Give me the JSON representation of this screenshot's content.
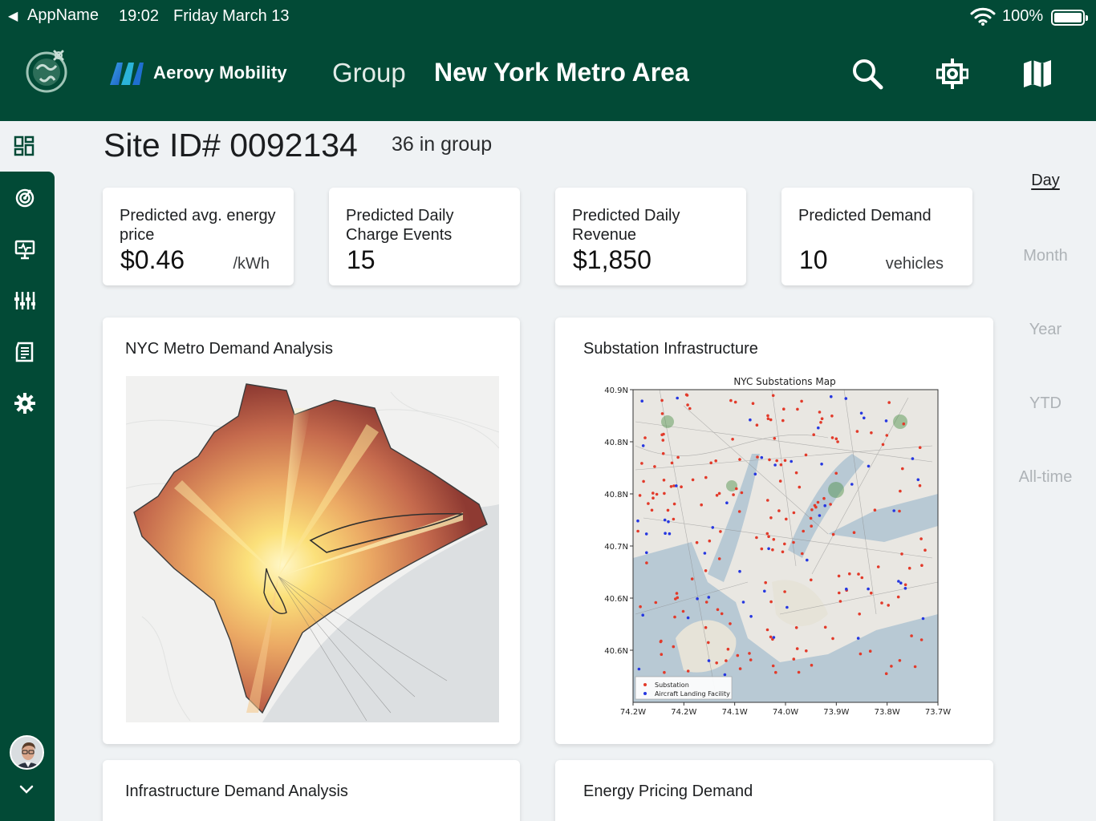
{
  "status_bar": {
    "back_glyph": "◀",
    "app": "AppName",
    "time": "19:02",
    "date": "Friday March 13",
    "battery": "100%",
    "battery_level": 1.0
  },
  "header": {
    "brand": "Aerovy Mobility",
    "group_label": "Group",
    "group_name": "New York Metro Area",
    "actions": [
      "search-icon",
      "site-target-icon",
      "map-icon"
    ]
  },
  "sidebar": {
    "items": [
      "dashboard-icon",
      "radar-icon",
      "monitor-icon",
      "sliders-icon",
      "report-icon",
      "gear-icon"
    ],
    "expand_icon": "chevron-down-icon"
  },
  "site": {
    "title": "Site ID# 0092134",
    "group_count": "36 in group"
  },
  "kpis": {
    "price": {
      "label": "Predicted avg. energy price",
      "value": "$0.46",
      "unit": "/kWh"
    },
    "events": {
      "label": "Predicted Daily Charge Events",
      "value": "15"
    },
    "revenue": {
      "label": "Predicted Daily Revenue",
      "value": "$1,850"
    },
    "demand": {
      "label": "Predicted Demand",
      "value": "10",
      "unit": "vehicles"
    }
  },
  "periods": [
    "Day",
    "Month",
    "Year",
    "YTD",
    "All-time"
  ],
  "active_period": "Day",
  "cards": {
    "demand": {
      "title": "NYC Metro Demand Analysis"
    },
    "substation": {
      "title": "Substation Infrastructure"
    },
    "infra": {
      "title": "Infrastructure Demand Analysis"
    },
    "energy": {
      "title": "Energy Pricing Demand"
    }
  },
  "chart_data": {
    "type": "scatter",
    "title": "NYC Substations Map",
    "xlabel": "",
    "ylabel": "",
    "x_ticks": [
      "74.2W",
      "74.2W",
      "74.1W",
      "74.0W",
      "73.9W",
      "73.8W",
      "73.7W"
    ],
    "y_ticks": [
      "40.9N",
      "40.8N",
      "40.8N",
      "40.7N",
      "40.6N",
      "40.6N"
    ],
    "legend": [
      "Substation",
      "Aircraft Landing Facility"
    ],
    "legend_position": "lower-left",
    "colors": {
      "Substation": "#e23a2a",
      "Aircraft Landing Facility": "#2637e0"
    }
  },
  "theme": {
    "header": "#024a36",
    "background": "#eff2f4",
    "muted": "#aeb3b7"
  }
}
